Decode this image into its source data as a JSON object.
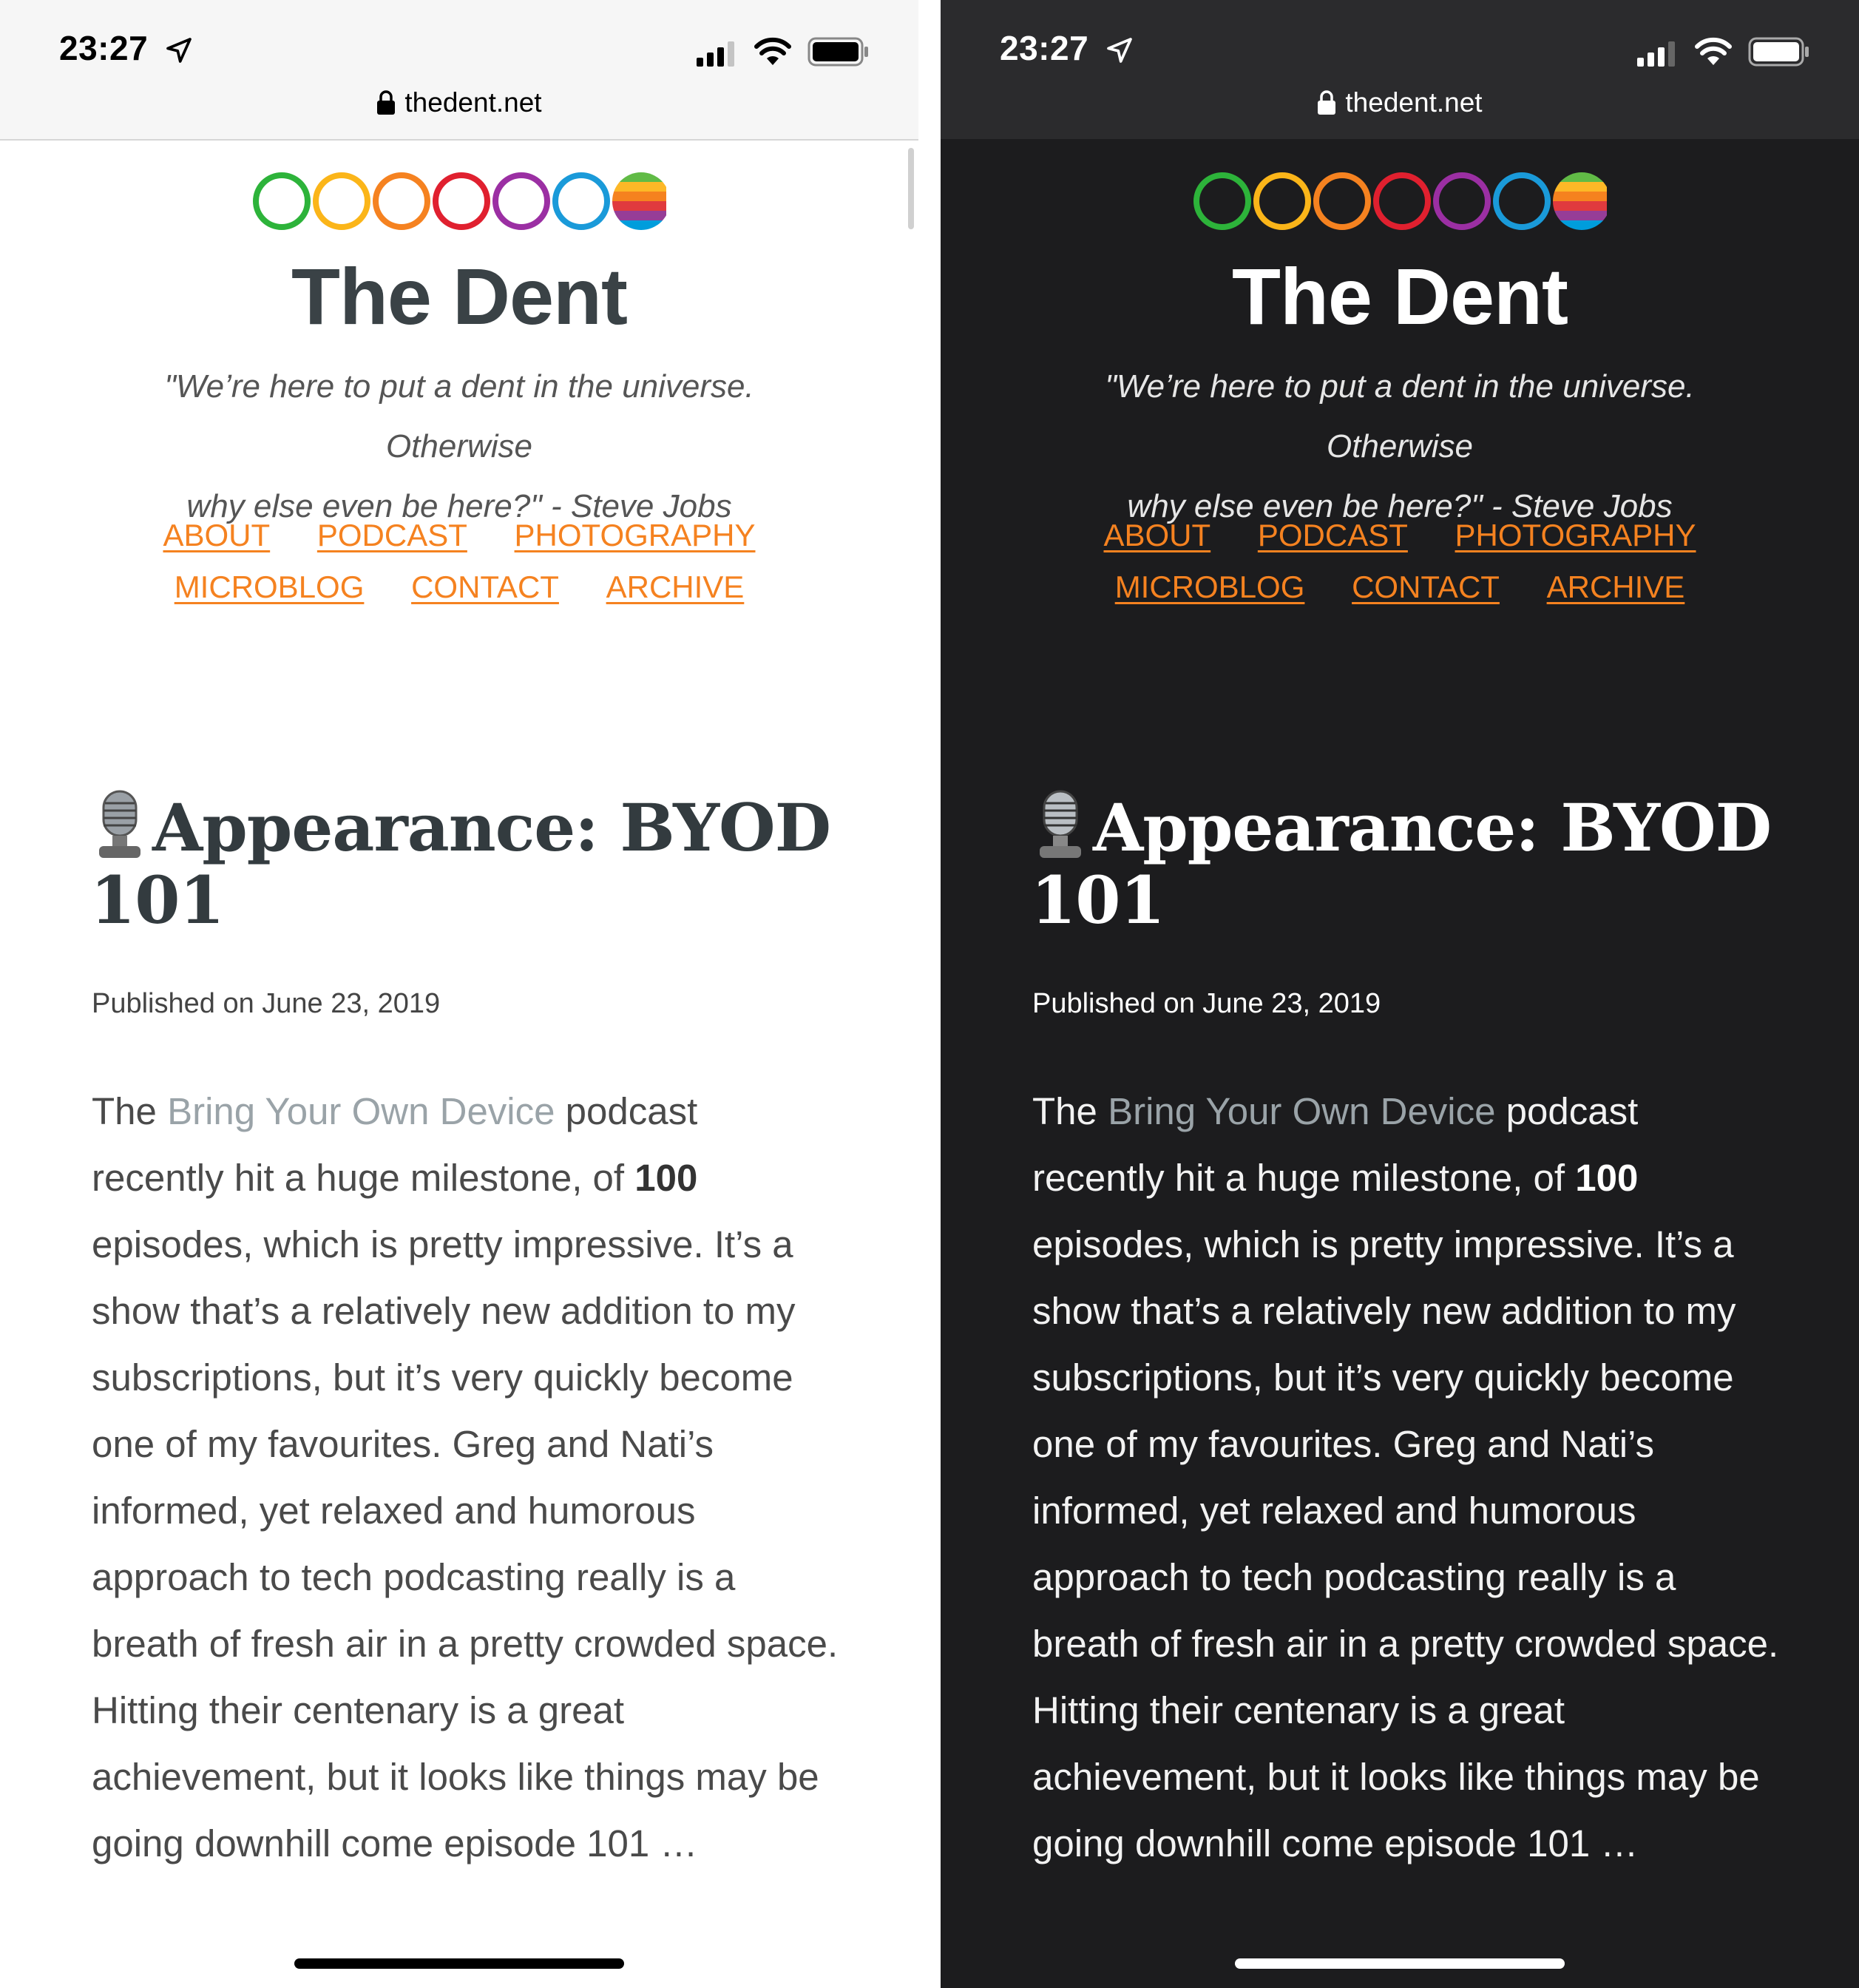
{
  "status_bar": {
    "time": "23:27",
    "icons": [
      "location-arrow-icon",
      "cellular-signal-icon",
      "wifi-icon",
      "battery-icon"
    ]
  },
  "browser": {
    "url": "thedent.net",
    "lock_icon": "lock-icon"
  },
  "site": {
    "logo_ring_colors": [
      "#2db33a",
      "#fbb519",
      "#f58220",
      "#e0202f",
      "#9b2fa3",
      "#1a9ad9"
    ],
    "logo_stripe_colors": [
      "#61bb46",
      "#fdb827",
      "#f5821f",
      "#e03a3e",
      "#963d97",
      "#009ddc"
    ],
    "title": "The Dent",
    "tagline_line1": "\"We’re here to put a dent in the universe. Otherwise",
    "tagline_line2": "why else even be here?\" - Steve Jobs",
    "nav_row1": [
      "ABOUT",
      "PODCAST",
      "PHOTOGRAPHY"
    ],
    "nav_row2": [
      "MICROBLOG",
      "CONTACT",
      "ARCHIVE"
    ],
    "link_color": "#f58220"
  },
  "post": {
    "icon": "microphone-icon",
    "title_line1": "Appearance: BYOD",
    "title_line2": "101",
    "meta": "Published on June 23, 2019",
    "body": {
      "p1": "The ",
      "link": "Bring Your Own Device",
      "p2": " podcast recently hit a huge milestone, of ",
      "bold": "100",
      "p3": " episodes, which is pretty impressive. It’s a show that’s a relatively new addition to my subscriptions, but it’s very quickly become one of my favourites. Greg and Nati’s informed, yet relaxed and humorous approach to tech podcasting really is a breath of fresh air in a pretty crowded space. Hitting their centenary is a great achievement, but it looks like things may be going downhill come episode 101 …"
    }
  },
  "themes": {
    "light_bg": "#ffffff",
    "dark_bg": "#1c1c1e"
  }
}
